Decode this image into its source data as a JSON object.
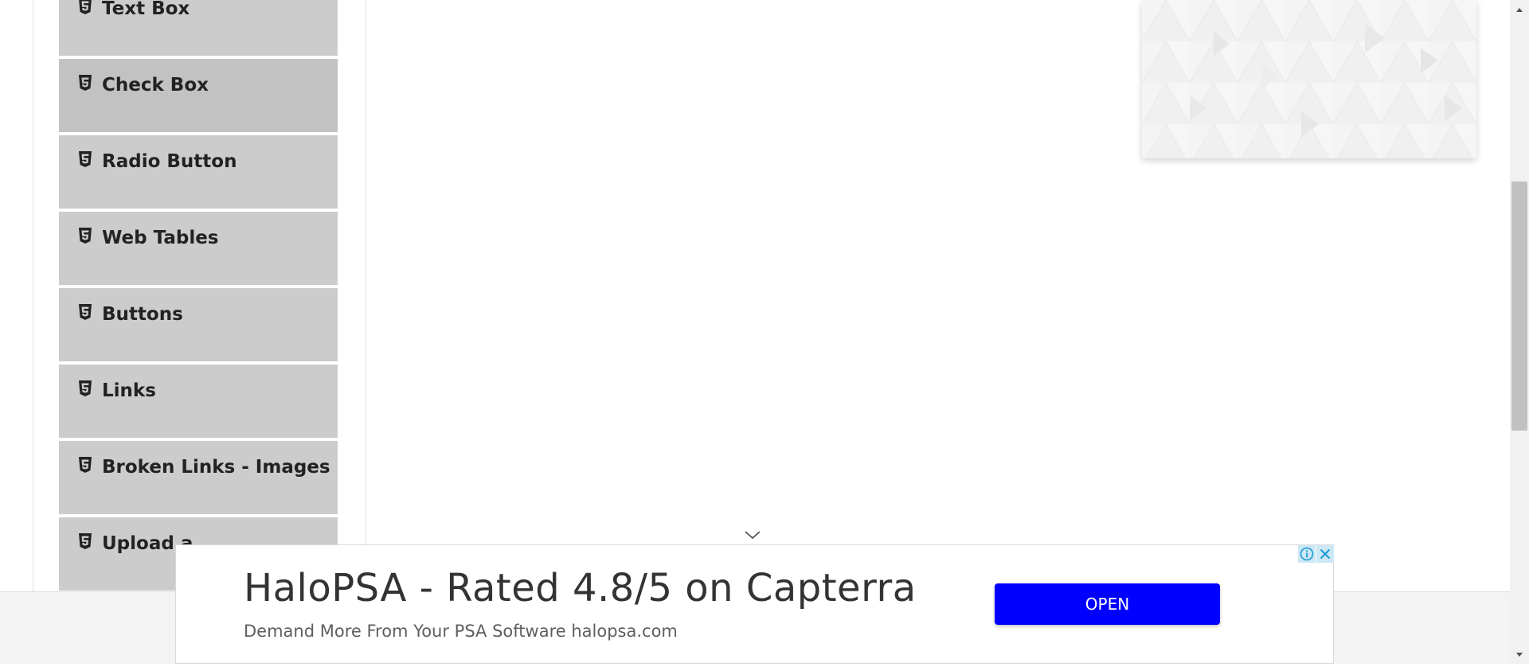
{
  "sidebar": {
    "items": [
      {
        "label": "Text Box"
      },
      {
        "label": "Check Box"
      },
      {
        "label": "Radio Button"
      },
      {
        "label": "Web Tables"
      },
      {
        "label": "Buttons"
      },
      {
        "label": "Links"
      },
      {
        "label": "Broken Links - Images"
      },
      {
        "label": "Upload a"
      }
    ]
  },
  "ad": {
    "headline": "HaloPSA - Rated 4.8/5 on Capterra",
    "description": "Demand More From Your PSA Software halopsa.com",
    "open_label": "OPEN",
    "button_color": "#0000ff",
    "info_icon": "info-icon",
    "close_icon": "close-icon"
  },
  "icons": {
    "menu_item": "html5-icon",
    "collapse": "chevron-down-icon",
    "scroll_up": "arrow-up-icon",
    "scroll_down": "arrow-down-icon"
  }
}
